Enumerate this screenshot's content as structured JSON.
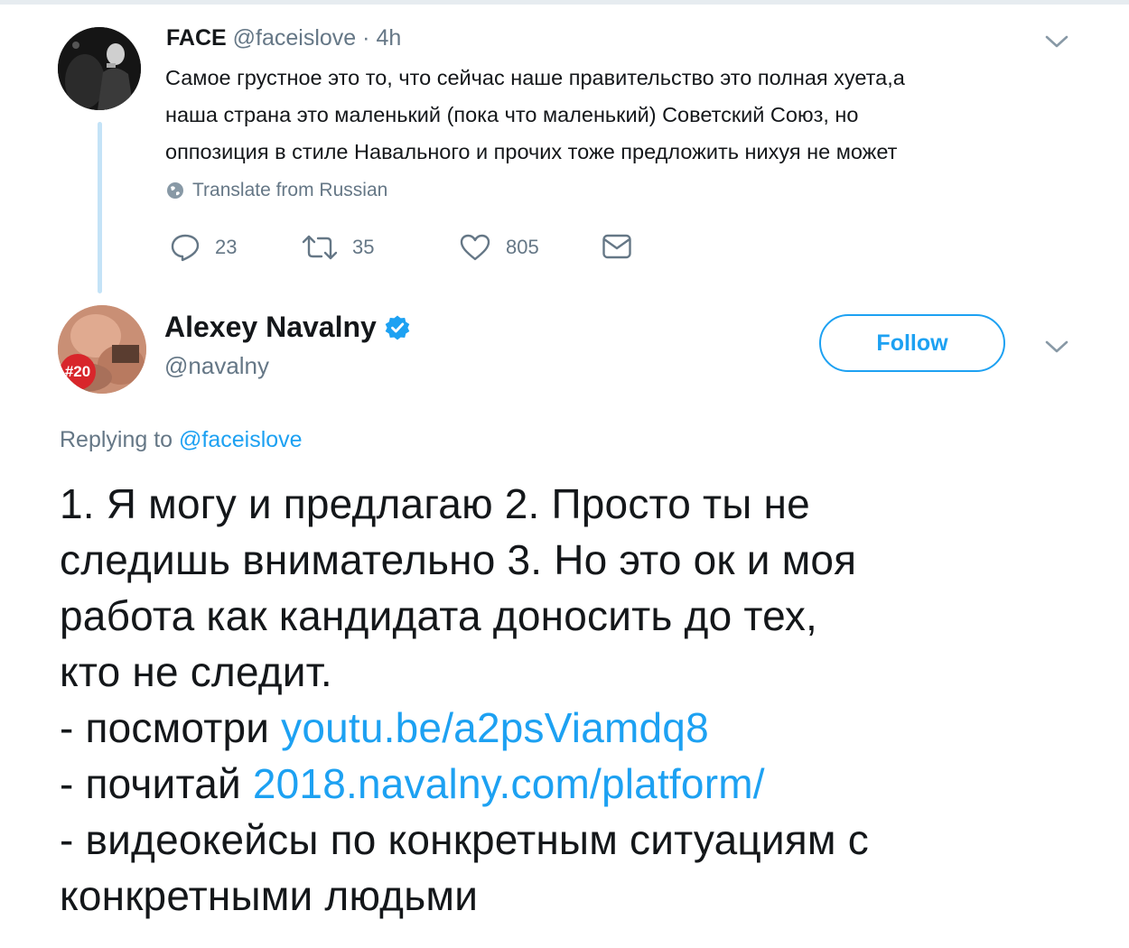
{
  "reply_tweet_parent": {
    "display_name": "FACE",
    "handle": "@faceislove",
    "separator": "·",
    "time": "4h",
    "body_lines": [
      "Самое грустное это то, что сейчас наше правительство это полная хуета,а",
      "наша страна это маленький (пока что маленький) Советский Союз, но",
      "оппозиция в стиле Навального и прочих тоже предложить нихуя не может"
    ],
    "translate_label": "Translate from Russian",
    "actions": {
      "replies": "23",
      "retweets": "35",
      "likes": "805"
    },
    "icons": {
      "reply": "reply-icon",
      "retweet": "retweet-icon",
      "like": "heart-icon",
      "dm": "envelope-icon",
      "menu": "chevron-down-icon",
      "translate": "globe-icon"
    }
  },
  "main_tweet": {
    "display_name": "Alexey Navalny",
    "handle": "@navalny",
    "verified": true,
    "follow_label": "Follow",
    "avatar_badge": "#20",
    "replying_prefix": "Replying to",
    "replying_to": "@faceislove",
    "body": {
      "line1": "1. Я могу и предлагаю 2. Просто ты не",
      "line2": "следишь внимательно 3. Но это ок и моя",
      "line3": "работа как кандидата доносить до тех,",
      "line4": "кто не следит.",
      "watch_prefix": "- посмотри ",
      "watch_link": "youtu.be/a2psViamdq8",
      "read_prefix": "- почитай ",
      "read_link": "2018.navalny.com/platform/",
      "line7": "- видеокейсы по конкретным ситуациям с",
      "line8": "конкретными людьми"
    }
  },
  "colors": {
    "accent": "#1da1f2",
    "secondary_text": "#657786",
    "primary_text": "#14171a",
    "thread_line": "#c4e3f7"
  }
}
